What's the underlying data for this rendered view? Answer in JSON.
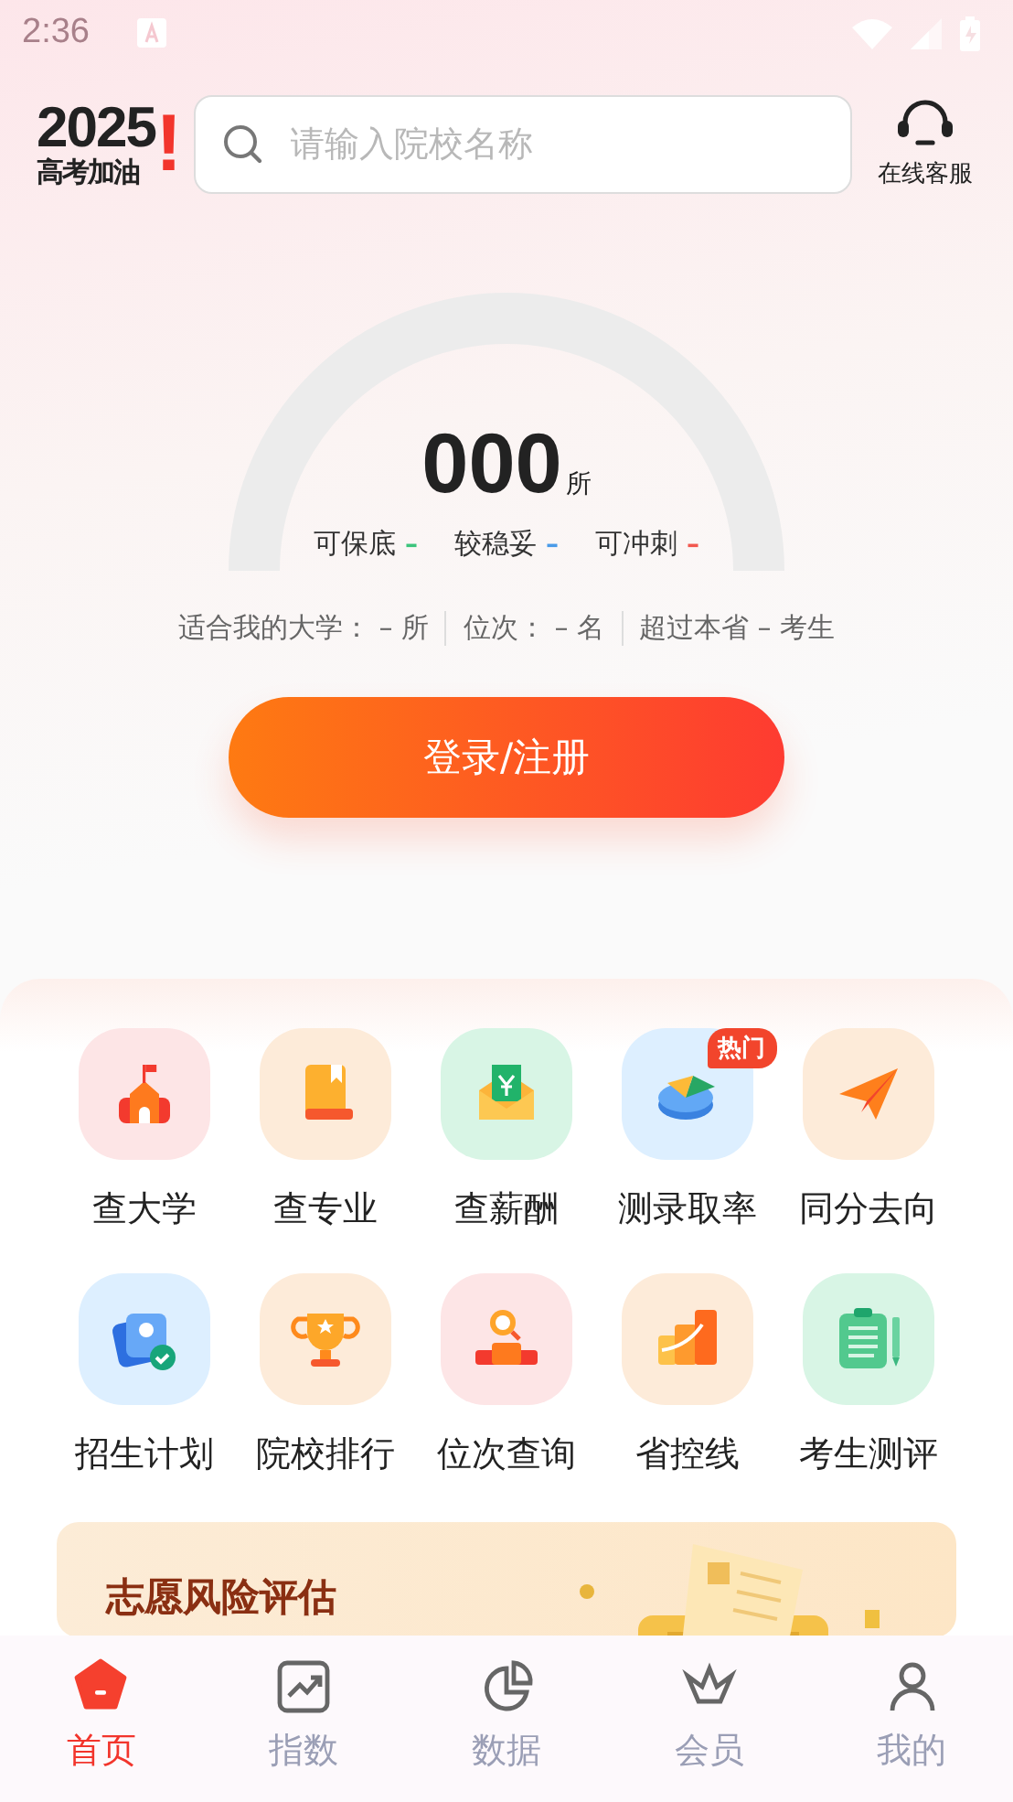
{
  "status_bar": {
    "time": "2:36"
  },
  "header": {
    "logo_year": "2025",
    "logo_exclaim": "!",
    "logo_slogan": "高考加油",
    "search": {
      "placeholder": "请输入院校名称"
    },
    "service": {
      "label": "在线客服"
    }
  },
  "gauge": {
    "count": "000",
    "unit": "所",
    "legend": [
      {
        "label": "可保底",
        "value": "–",
        "color": "#3cc47c"
      },
      {
        "label": "较稳妥",
        "value": "–",
        "color": "#4a9be8"
      },
      {
        "label": "可冲刺",
        "value": "–",
        "color": "#f2584f"
      }
    ]
  },
  "stats": [
    {
      "label": "适合我的大学：",
      "value": "– 所"
    },
    {
      "label": "位次：",
      "value": "– 名"
    },
    {
      "label": "超过本省",
      "value": "– 考生"
    }
  ],
  "login_button": {
    "label": "登录/注册"
  },
  "tools": [
    {
      "label": "查大学",
      "kind": "school"
    },
    {
      "label": "查专业",
      "kind": "book"
    },
    {
      "label": "查薪酬",
      "kind": "salary"
    },
    {
      "label": "测录取率",
      "kind": "pie",
      "badge": "热门"
    },
    {
      "label": "同分去向",
      "kind": "plane"
    },
    {
      "label": "招生计划",
      "kind": "plan"
    },
    {
      "label": "院校排行",
      "kind": "trophy"
    },
    {
      "label": "位次查询",
      "kind": "rank"
    },
    {
      "label": "省控线",
      "kind": "bars"
    },
    {
      "label": "考生测评",
      "kind": "test"
    }
  ],
  "banner": {
    "title": "志愿风险评估"
  },
  "tab_bar": [
    {
      "label": "首页",
      "kind": "home",
      "selected": true
    },
    {
      "label": "指数",
      "kind": "index",
      "selected": false
    },
    {
      "label": "数据",
      "kind": "data",
      "selected": false
    },
    {
      "label": "会员",
      "kind": "vip",
      "selected": false
    },
    {
      "label": "我的",
      "kind": "me",
      "selected": false
    }
  ]
}
